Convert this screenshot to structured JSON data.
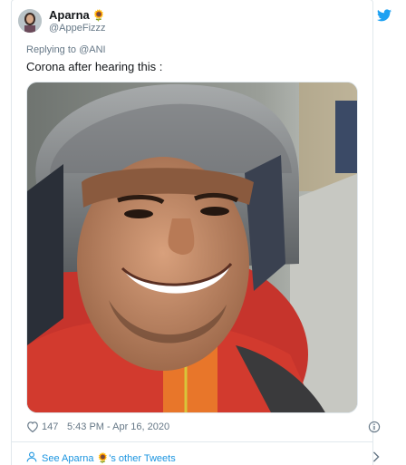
{
  "author": {
    "name": "Aparna",
    "name_emoji": "🌻",
    "handle": "@AppeFizzz"
  },
  "icons": {
    "brand": "twitter-bird-icon",
    "like": "heart-icon",
    "info": "info-icon",
    "person": "person-icon",
    "chevron": "chevron-right-icon"
  },
  "reply": {
    "prefix": "Replying to",
    "mention": "@ANI"
  },
  "tweet": {
    "text": "Corona after hearing this :",
    "likes": "147",
    "timestamp": "5:43 PM - Apr 16, 2020"
  },
  "footer": {
    "see_prefix": "See Aparna",
    "see_emoji": "🌻",
    "see_suffix": "'s other Tweets"
  },
  "colors": {
    "accent": "#1da1f2",
    "link": "#1b95e0",
    "muted": "#657786",
    "border": "#e1e8ed"
  }
}
